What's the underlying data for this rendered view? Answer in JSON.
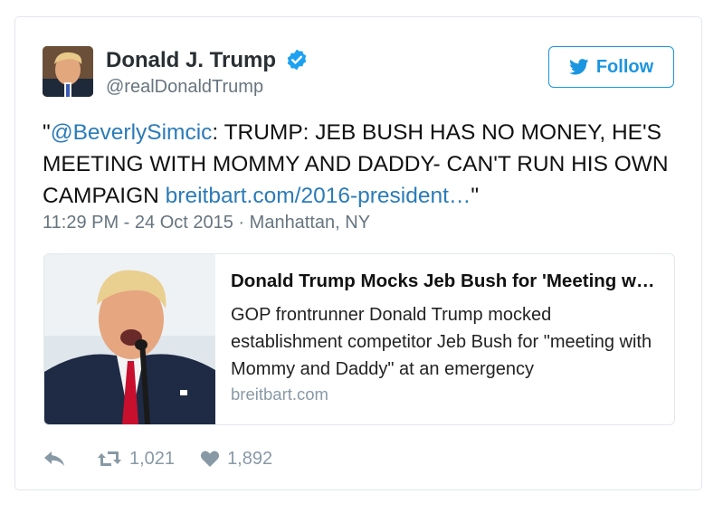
{
  "tweet": {
    "author": {
      "name": "Donald J. Trump",
      "handle": "@realDonaldTrump",
      "verified": true
    },
    "follow_label": "Follow",
    "text": {
      "open_quote": "\"",
      "mention": "@BeverlySimcic",
      "body": ": TRUMP: JEB BUSH HAS NO MONEY, HE'S MEETING WITH MOMMY AND DADDY- CAN'T RUN HIS OWN CAMPAIGN ",
      "link": "breitbart.com/2016-president…",
      "close_quote": "\""
    },
    "timestamp": "11:29 PM - 24 Oct 2015",
    "separator": "·",
    "location": "Manhattan, NY",
    "card": {
      "title": "Donald Trump Mocks Jeb Bush for 'Meeting with Mommy and Daddy'",
      "description": "GOP frontrunner Donald Trump mocked establishment competitor Jeb Bush for \"meeting with Mommy and Daddy\" at an emergency",
      "domain": "breitbart.com"
    },
    "stats": {
      "retweets": "1,021",
      "likes": "1,892"
    },
    "icons": {
      "verified": "verified-badge-icon",
      "follow": "twitter-bird-icon",
      "reply": "reply-icon",
      "retweet": "retweet-icon",
      "like": "heart-icon"
    },
    "colors": {
      "accent": "#1b95e0",
      "link": "#2b7bb9",
      "muted": "#66757f",
      "action": "#8899a6"
    }
  }
}
